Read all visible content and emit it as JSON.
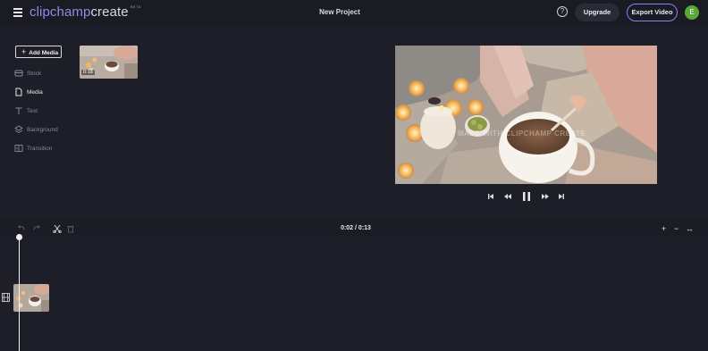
{
  "header": {
    "logo_clip": "clipchamp",
    "logo_create": "create",
    "logo_beta": "BETA",
    "project_title": "New Project",
    "help_icon": "?",
    "upgrade_label": "Upgrade",
    "export_label": "Export Video",
    "avatar_initial": "E",
    "accent": "#8a80f0"
  },
  "sidebar": {
    "add_media_label": "Add Media",
    "items": [
      {
        "label": "Stock",
        "icon": "stock-icon"
      },
      {
        "label": "Media",
        "icon": "file-icon"
      },
      {
        "label": "Text",
        "icon": "text-icon"
      },
      {
        "label": "Background",
        "icon": "layers-icon"
      },
      {
        "label": "Transition",
        "icon": "transition-icon"
      }
    ]
  },
  "media": {
    "thumb_duration": "0:13"
  },
  "preview": {
    "watermark": "MADE WITH CLIPCHAMP CREATE"
  },
  "timeline": {
    "time": "0:02 / 0:13",
    "zoom_in": "+",
    "zoom_out": "−",
    "fit": "↔"
  }
}
